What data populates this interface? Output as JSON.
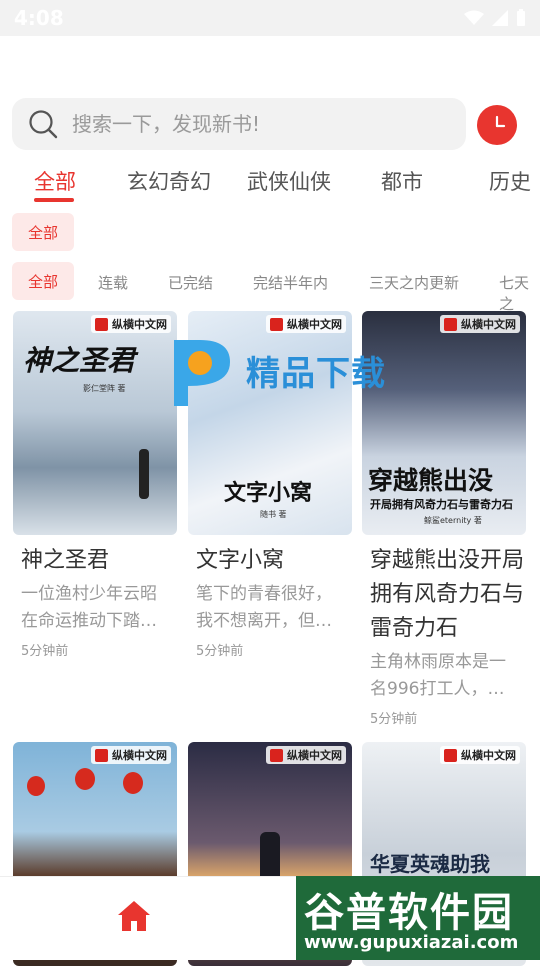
{
  "status": {
    "time": "4:08"
  },
  "search": {
    "placeholder": "搜索一下，发现新书!"
  },
  "tabs": [
    {
      "label": "全部",
      "active": true
    },
    {
      "label": "玄幻奇幻"
    },
    {
      "label": "武侠仙侠"
    },
    {
      "label": "都市"
    },
    {
      "label": "历史"
    }
  ],
  "category_chip": "全部",
  "filters": [
    "全部",
    "连载",
    "已完结",
    "完结半年内",
    "三天之内更新",
    "七天之"
  ],
  "publisher": "纵横中文网",
  "books": [
    {
      "title": "神之圣君",
      "desc": "一位渔村少年云昭在命运推动下踏…",
      "time": "5分钟前",
      "cover_text": "神之圣君",
      "cover_author": "影仁堂阵 著"
    },
    {
      "title": "文字小窝",
      "desc": "笔下的青春很好，我不想离开，但…",
      "time": "5分钟前",
      "cover_text": "文字小窝",
      "cover_author": "随书 著"
    },
    {
      "title": "穿越熊出没开局拥有风奇力石与雷奇力石",
      "desc": "主角林雨原本是一名996打工人，…",
      "time": "5分钟前",
      "cover_text": "穿越熊出没",
      "cover_sub": "开局拥有风奇力石与雷奇力石",
      "cover_author": "鲸鲨eternity 著"
    },
    {
      "title": "",
      "desc": "",
      "time": ""
    },
    {
      "title": "",
      "desc": "",
      "time": ""
    },
    {
      "title": "",
      "desc": "",
      "time": "",
      "cover_text": "华夏英魂助我"
    }
  ],
  "watermarks": {
    "top": "精品下载",
    "bottom": "谷普软件园",
    "bottom_url": "www.gupuxiazai.com"
  },
  "colors": {
    "accent": "#e8352f",
    "chip_bg": "#fde9e8"
  }
}
